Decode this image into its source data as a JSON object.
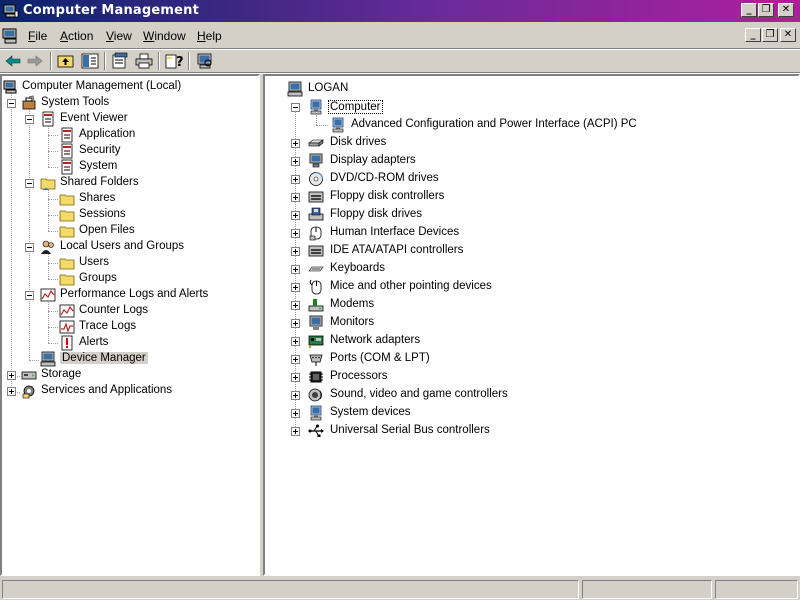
{
  "window": {
    "title": "Computer Management",
    "app_icon": "computer-management-icon"
  },
  "menubar": {
    "items": [
      {
        "label": "File",
        "accel": "F",
        "rest": "ile"
      },
      {
        "label": "Action",
        "accel": "A",
        "rest": "ction"
      },
      {
        "label": "View",
        "accel": "V",
        "rest": "iew"
      },
      {
        "label": "Window",
        "accel": "W",
        "rest": "indow"
      },
      {
        "label": "Help",
        "accel": "H",
        "rest": "elp"
      }
    ]
  },
  "toolbar": {
    "buttons": [
      "back-arrow-icon",
      "forward-arrow-icon",
      "up-folder-icon",
      "show-hide-tree-icon",
      "properties-icon",
      "print-icon",
      "help-icon",
      "scan-hardware-icon"
    ]
  },
  "left_tree": {
    "root": "Computer Management (Local)",
    "system_tools": "System Tools",
    "event_viewer": "Event Viewer",
    "application": "Application",
    "security": "Security",
    "system": "System",
    "shared_folders": "Shared Folders",
    "shares": "Shares",
    "sessions": "Sessions",
    "open_files": "Open Files",
    "local_users": "Local Users and Groups",
    "users": "Users",
    "groups": "Groups",
    "perf_logs": "Performance Logs and Alerts",
    "counter_logs": "Counter Logs",
    "trace_logs": "Trace Logs",
    "alerts": "Alerts",
    "device_manager": "Device Manager",
    "storage": "Storage",
    "services": "Services and Applications"
  },
  "device_tree": {
    "root": "LOGAN",
    "computer": "Computer",
    "acpi": "Advanced Configuration and Power Interface (ACPI) PC",
    "categories": [
      "Disk drives",
      "Display adapters",
      "DVD/CD-ROM drives",
      "Floppy disk controllers",
      "Floppy disk drives",
      "Human Interface Devices",
      "IDE ATA/ATAPI controllers",
      "Keyboards",
      "Mice and other pointing devices",
      "Modems",
      "Monitors",
      "Network adapters",
      "Ports (COM & LPT)",
      "Processors",
      "Sound, video and game controllers",
      "System devices",
      "Universal Serial Bus controllers"
    ]
  }
}
